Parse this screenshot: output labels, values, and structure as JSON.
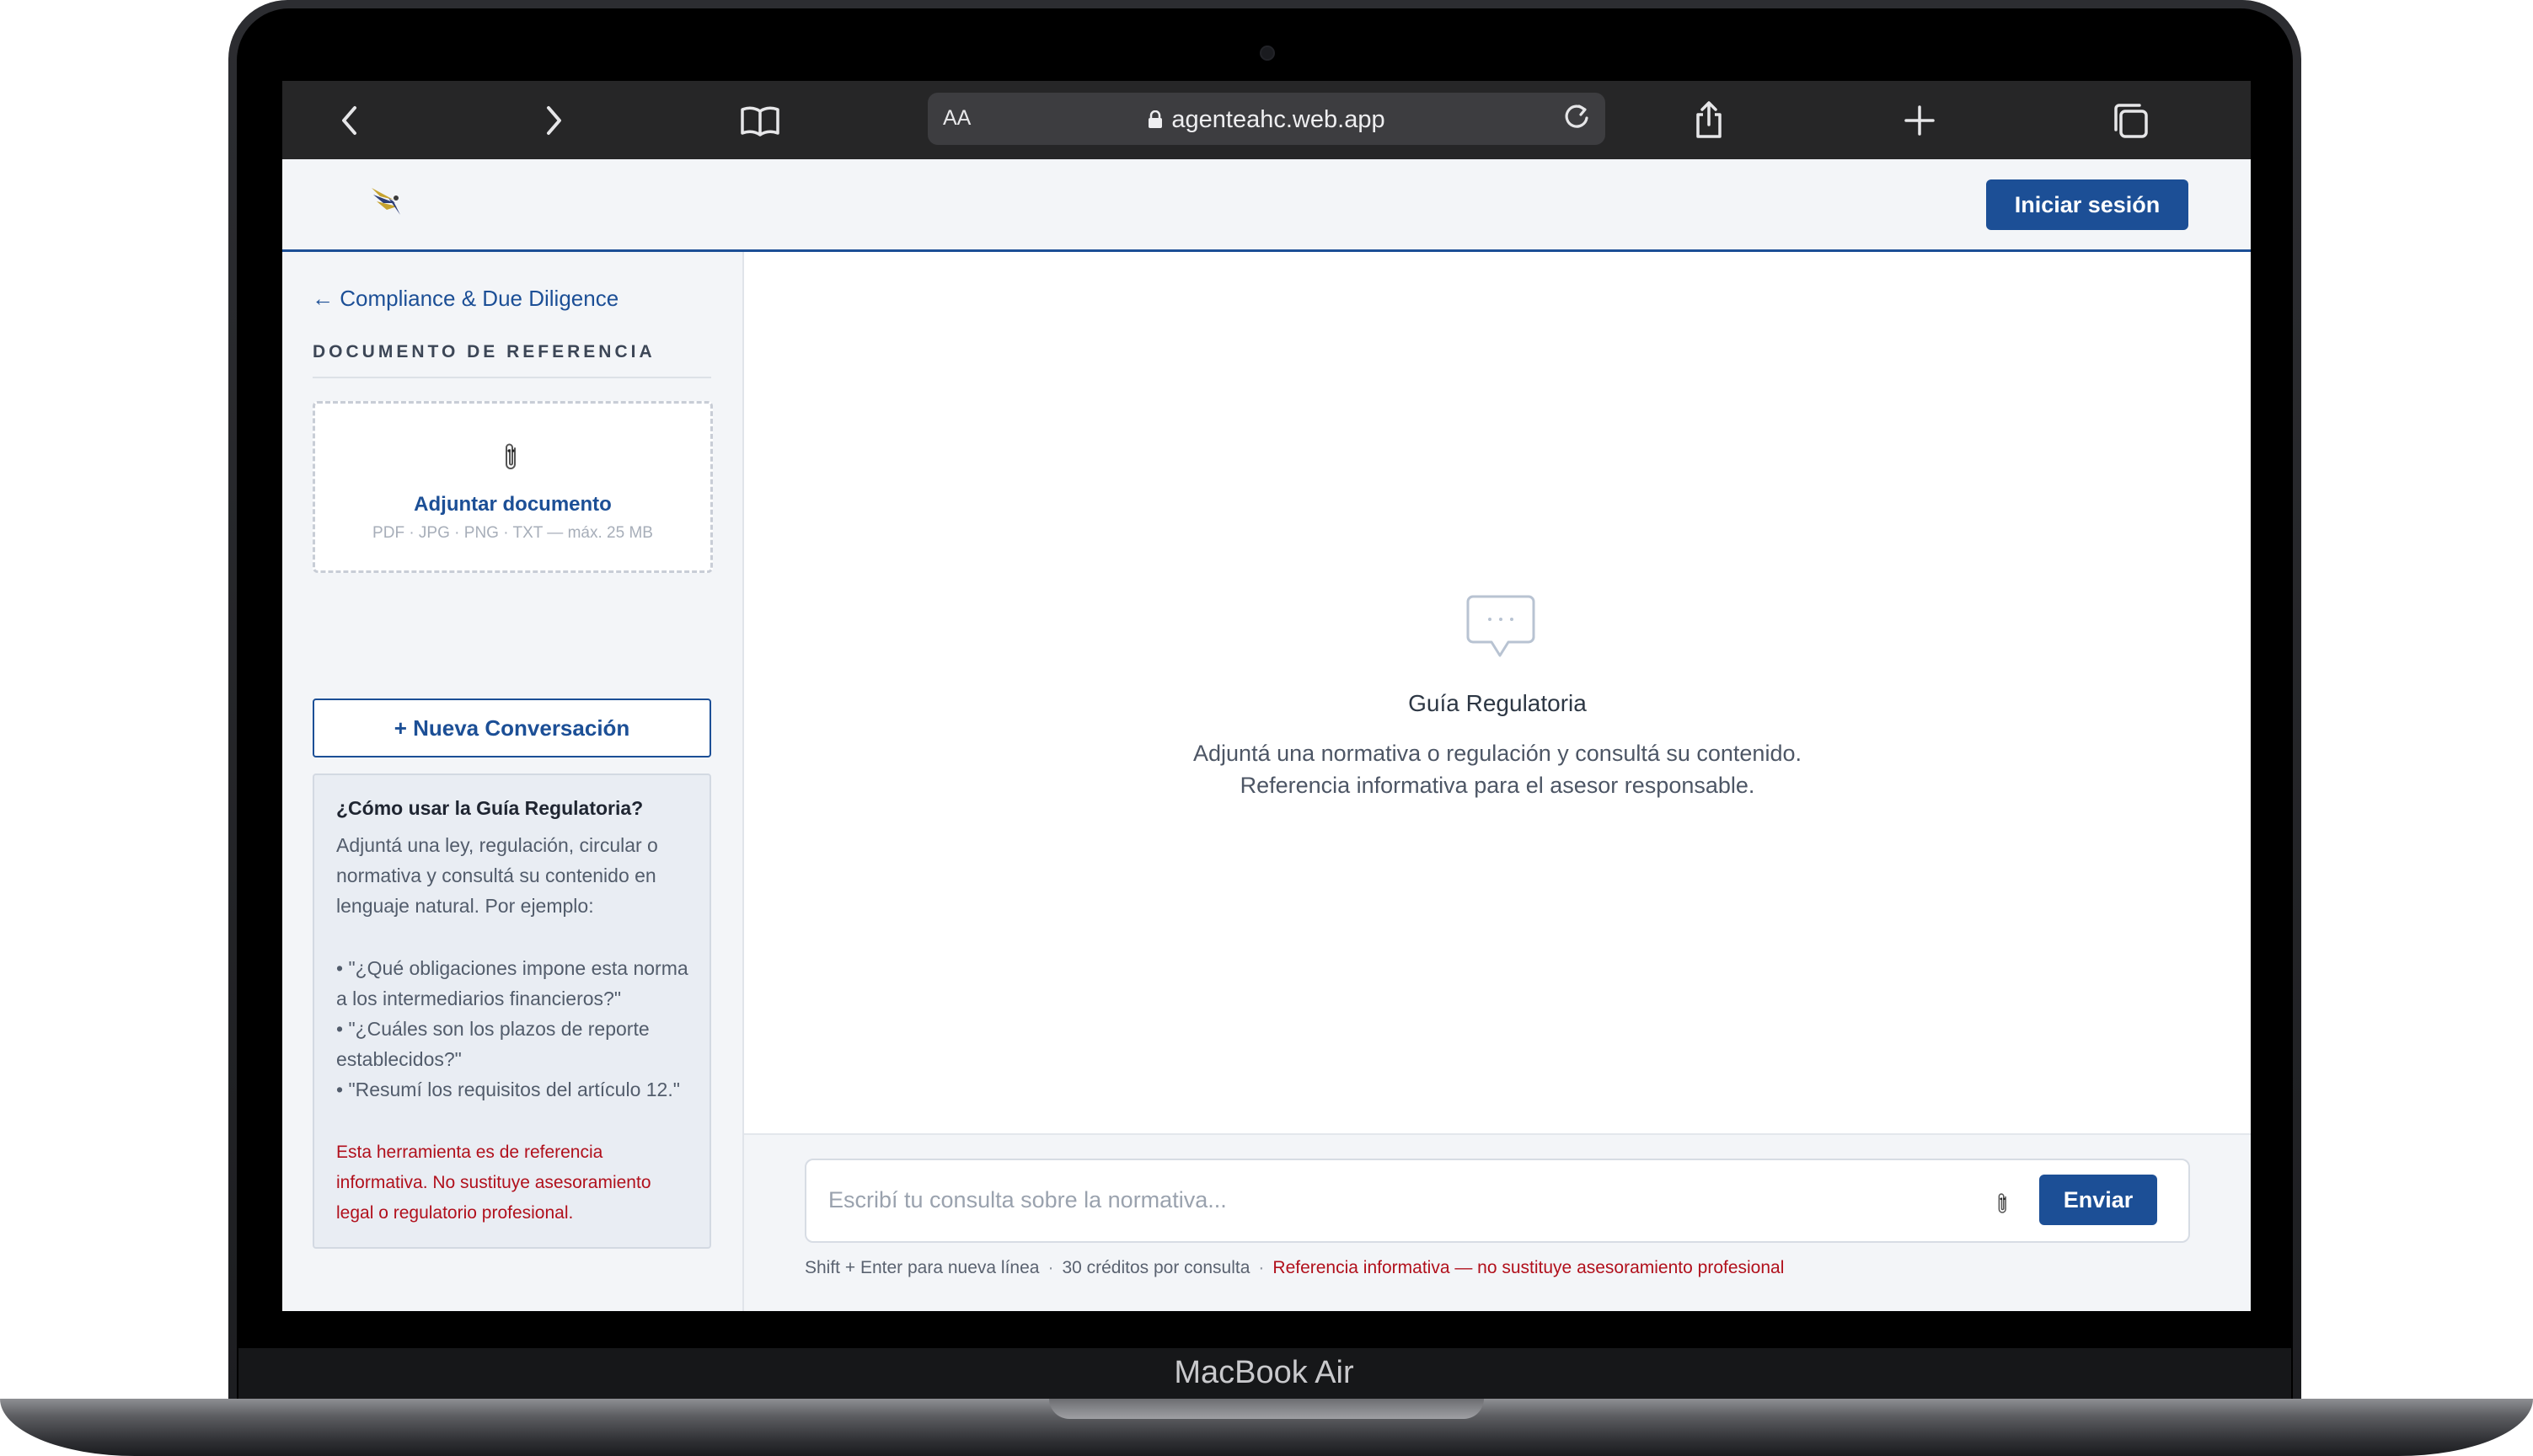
{
  "device": {
    "label": "MacBook Air"
  },
  "browser": {
    "text_size_label": "AA",
    "url": "agenteahc.web.app"
  },
  "header": {
    "login_label": "Iniciar sesión"
  },
  "sidebar": {
    "back_link": "← Compliance & Due Diligence",
    "section_title": "DOCUMENTO DE REFERENCIA",
    "upload": {
      "title": "Adjuntar documento",
      "formats": "PDF · JPG · PNG · TXT — máx. 25 MB"
    },
    "new_conversation_label": "+ Nueva Conversación",
    "help": {
      "title": "¿Cómo usar la Guía Regulatoria?",
      "lines": [
        "Adjuntá una ley, regulación, circular o",
        "normativa y consultá su contenido en",
        "lenguaje natural. Por ejemplo:",
        "• \"¿Qué obligaciones impone esta norma",
        "a los intermediarios financieros?\"",
        "• \"¿Cuáles son los plazos de reporte",
        "establecidos?\"",
        "• \"Resumí los requisitos del artículo 12.\""
      ],
      "warning_lines": [
        "Esta herramienta es de referencia",
        "informativa. No sustituye asesoramiento",
        "legal o regulatorio profesional."
      ]
    }
  },
  "main": {
    "empty_title": "Guía Regulatoria",
    "empty_desc_1": "Adjuntá una normativa o regulación y consultá su contenido.",
    "empty_desc_2": "Referencia informativa para el asesor responsable."
  },
  "composer": {
    "placeholder": "Escribí tu consulta sobre la normativa...",
    "send_label": "Enviar",
    "hint_newline": "Shift + Enter para nueva línea",
    "hint_credits": "30 créditos por consulta",
    "hint_warning": "Referencia informativa — no sustituye asesoramiento profesional"
  },
  "colors": {
    "brand_blue": "#1c4f96",
    "warning_red": "#b1101c",
    "sidebar_bg": "#f3f5f8"
  },
  "icons": [
    "back-icon",
    "forward-icon",
    "bookmarks-icon",
    "lock-icon",
    "reload-icon",
    "share-icon",
    "new-tab-icon",
    "tabs-icon",
    "logo-icon",
    "paperclip-icon",
    "chat-bubble-icon"
  ]
}
